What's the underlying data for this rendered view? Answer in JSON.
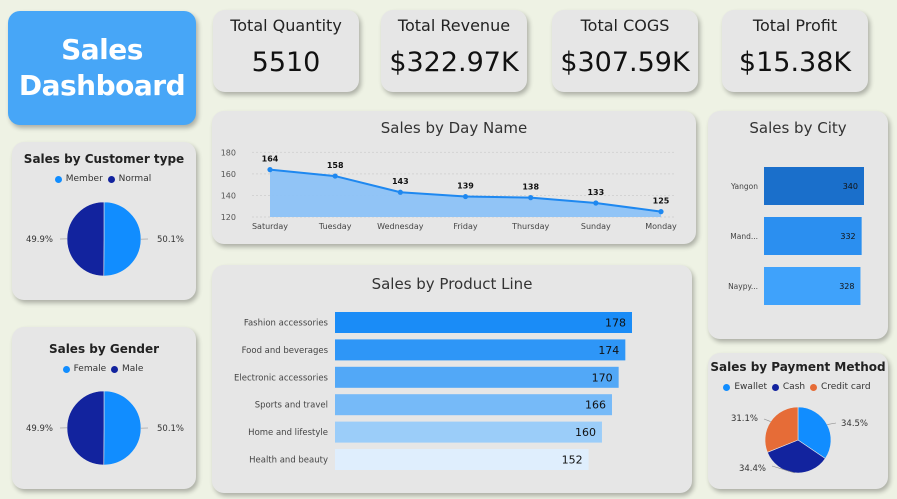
{
  "title": {
    "line1": "Sales",
    "line2": "Dashboard"
  },
  "kpis": [
    {
      "label": "Total Quantity",
      "value": "5510"
    },
    {
      "label": "Total Revenue",
      "value": "$322.97K"
    },
    {
      "label": "Total COGS",
      "value": "$307.59K"
    },
    {
      "label": "Total Profit",
      "value": "$15.38K"
    }
  ],
  "colors": {
    "background": "#eef2e4",
    "card": "#e6e6e6",
    "title_card": "#47a6f7",
    "line": "#1e88f0",
    "area": "#8cc2f7"
  },
  "chart_data": [
    {
      "type": "area",
      "title": "Sales by Day Name",
      "categories": [
        "Saturday",
        "Tuesday",
        "Wednesday",
        "Friday",
        "Thursday",
        "Sunday",
        "Monday"
      ],
      "values": [
        164,
        158,
        143,
        139,
        138,
        133,
        125
      ],
      "yticks": [
        120,
        140,
        160,
        180
      ],
      "ylim": [
        120,
        185
      ],
      "grid": true,
      "color": "#1e88f0"
    },
    {
      "type": "bar",
      "orientation": "horizontal",
      "title": "Sales by Product Line",
      "categories": [
        "Fashion accessories",
        "Food and beverages",
        "Electronic accessories",
        "Sports and travel",
        "Home and lifestyle",
        "Health and beauty"
      ],
      "values": [
        178,
        174,
        170,
        166,
        160,
        152
      ],
      "colors": [
        "#1a8cf7",
        "#2e96f7",
        "#52a8f7",
        "#76baf8",
        "#9bcdf9",
        "#dfeefd"
      ],
      "xlim": [
        0,
        178
      ]
    },
    {
      "type": "bar",
      "orientation": "horizontal",
      "title": "Sales by City",
      "categories": [
        "Yangon",
        "Mand...",
        "Naypy..."
      ],
      "values": [
        340,
        332,
        328
      ],
      "colors": [
        "#1a6fcb",
        "#2b8ff0",
        "#3fa2fb"
      ],
      "xlim": [
        0,
        340
      ]
    },
    {
      "type": "pie",
      "title": "Sales by Customer type",
      "legend_position": "top",
      "series": [
        {
          "name": "Member",
          "value": 50.1,
          "label": "50.1%",
          "color": "#118dff"
        },
        {
          "name": "Normal",
          "value": 49.9,
          "label": "49.9%",
          "color": "#12239e"
        }
      ]
    },
    {
      "type": "pie",
      "title": "Sales by Gender",
      "legend_position": "top",
      "series": [
        {
          "name": "Female",
          "value": 50.1,
          "label": "50.1%",
          "color": "#118dff"
        },
        {
          "name": "Male",
          "value": 49.9,
          "label": "49.9%",
          "color": "#12239e"
        }
      ]
    },
    {
      "type": "pie",
      "title": "Sales by Payment Method",
      "legend_position": "top",
      "series": [
        {
          "name": "Ewallet",
          "value": 34.5,
          "label": "34.5%",
          "color": "#118dff"
        },
        {
          "name": "Cash",
          "value": 34.4,
          "label": "34.4%",
          "color": "#12239e"
        },
        {
          "name": "Credit card",
          "value": 31.1,
          "label": "31.1%",
          "color": "#e66c37"
        }
      ]
    }
  ]
}
